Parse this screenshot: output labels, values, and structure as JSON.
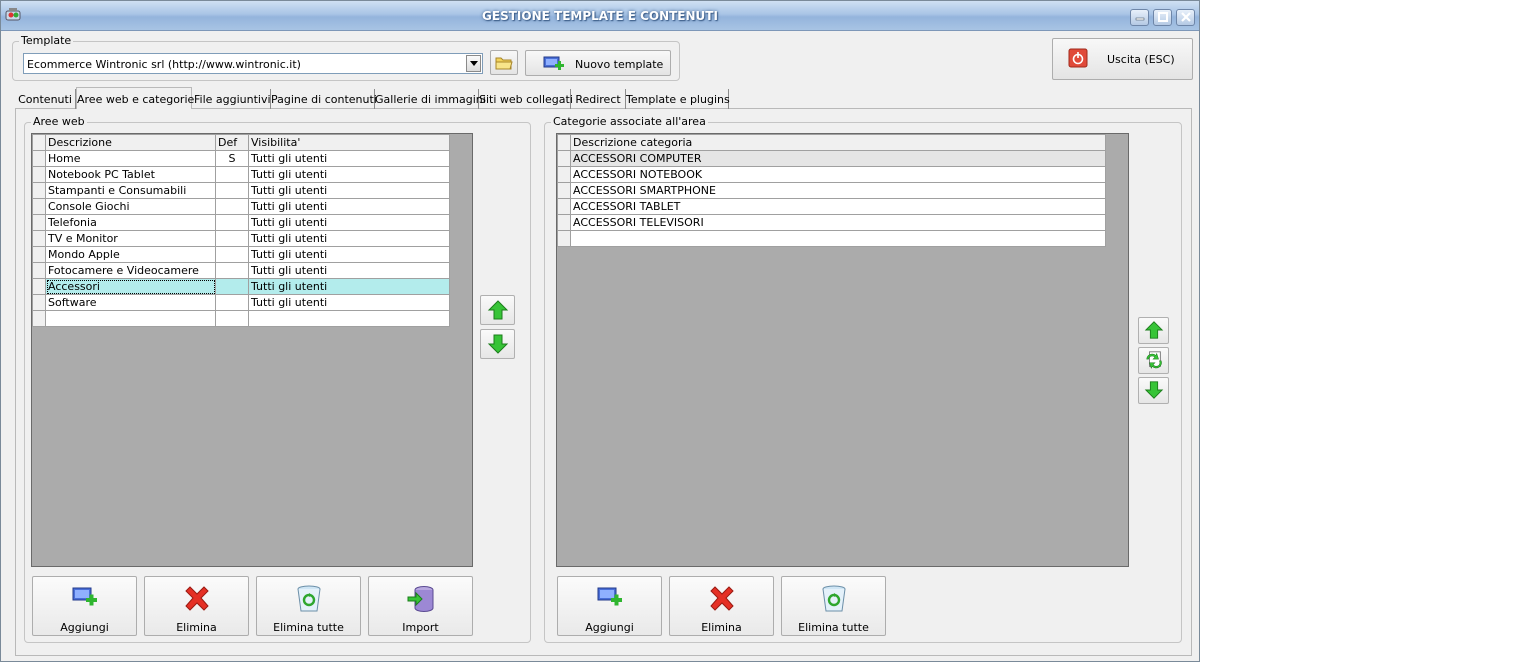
{
  "window": {
    "title": "GESTIONE TEMPLATE E CONTENUTI"
  },
  "template": {
    "legend": "Template",
    "selected": "Ecommerce Wintronic srl (http://www.wintronic.it)",
    "new_button": "Nuovo template"
  },
  "exit_button": "Uscita (ESC)",
  "tabs": [
    {
      "label": "Contenuti"
    },
    {
      "label": "Aree web e categorie"
    },
    {
      "label": "File aggiuntivi"
    },
    {
      "label": "Pagine di contenuti"
    },
    {
      "label": "Gallerie di immagini"
    },
    {
      "label": "Siti web collegati"
    },
    {
      "label": "Redirect"
    },
    {
      "label": "Template e plugins"
    }
  ],
  "areas": {
    "legend": "Aree web",
    "columns": [
      "Descrizione",
      "Def",
      "Visibilita'"
    ],
    "rows": [
      {
        "desc": "Home",
        "def": "S",
        "vis": "Tutti gli utenti"
      },
      {
        "desc": "Notebook  PC Tablet",
        "def": "",
        "vis": "Tutti gli utenti"
      },
      {
        "desc": "Stampanti e Consumabili",
        "def": "",
        "vis": "Tutti gli utenti"
      },
      {
        "desc": "Console Giochi",
        "def": "",
        "vis": "Tutti gli utenti"
      },
      {
        "desc": "Telefonia",
        "def": "",
        "vis": "Tutti gli utenti"
      },
      {
        "desc": "TV e Monitor",
        "def": "",
        "vis": "Tutti gli utenti"
      },
      {
        "desc": "Mondo Apple",
        "def": "",
        "vis": "Tutti gli utenti"
      },
      {
        "desc": "Fotocamere e Videocamere",
        "def": "",
        "vis": "Tutti gli utenti"
      },
      {
        "desc": "Accessori",
        "def": "",
        "vis": "Tutti gli utenti"
      },
      {
        "desc": "Software",
        "def": "",
        "vis": "Tutti gli utenti"
      },
      {
        "desc": "",
        "def": "",
        "vis": ""
      }
    ],
    "buttons": {
      "add": "Aggiungi",
      "delete": "Elimina",
      "delete_all": "Elimina tutte",
      "import": "Import"
    }
  },
  "categories": {
    "legend": "Categorie associate all'area",
    "columns": [
      "Descrizione categoria"
    ],
    "rows": [
      {
        "desc": "ACCESSORI COMPUTER"
      },
      {
        "desc": "ACCESSORI NOTEBOOK"
      },
      {
        "desc": "ACCESSORI SMARTPHONE"
      },
      {
        "desc": "ACCESSORI TABLET"
      },
      {
        "desc": "ACCESSORI TELEVISORI"
      },
      {
        "desc": ""
      }
    ],
    "buttons": {
      "add": "Aggiungi",
      "delete": "Elimina",
      "delete_all": "Elimina tutte"
    }
  }
}
